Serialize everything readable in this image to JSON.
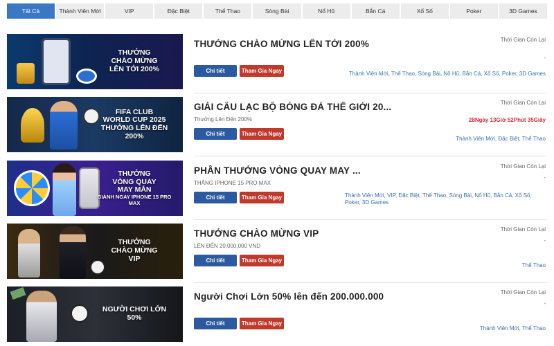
{
  "tabs": [
    "Tất Cả",
    "Thành Viên Mới",
    "VIP",
    "Đặc Biệt",
    "Thể Thao",
    "Sòng Bài",
    "Nổ Hũ",
    "Bắn Cá",
    "Xổ Số",
    "Poker",
    "3D Games"
  ],
  "labels": {
    "detail": "Chi tiết",
    "join": "Tham Gia Ngay",
    "time_remaining": "Thời Gian Còn Lại"
  },
  "promos": [
    {
      "title": "THƯỞNG CHÀO MỪNG LÊN TỚI 200%",
      "subtitle": "",
      "banner": [
        "THƯỞNG",
        "CHÀO MỪNG",
        "LÊN TỚI 200%"
      ],
      "banner_small": "",
      "time": "-",
      "categories": "Thành Viên Mới, Thể Thao, Sòng Bài, Nổ Hũ, Bắn Cá, Xổ Số, Poker, 3D Games"
    },
    {
      "title": "GIẢI CÂU LẠC BỘ BÓNG ĐÁ THẾ GIỚI 20...",
      "subtitle": "Thưởng Lên Đến 200%",
      "banner": [
        "FIFA CLUB",
        "WORLD CUP 2025",
        "THƯỞNG LÊN ĐẾN",
        "200%"
      ],
      "banner_small": "",
      "time": "28Ngày 13Giờ 52Phút 35Giây",
      "categories": "Thành Viên Mới, Đặc Biệt, Thể Thao"
    },
    {
      "title": "PHẦN THƯỞNG VÒNG QUAY MAY ...",
      "subtitle": "THẮNG IPHONE 15 PRO MAX",
      "banner": [
        "THƯỞNG",
        "VÒNG QUAY",
        "MAY MẮN"
      ],
      "banner_small": "GIÀNH NGAY IPHONE 15 PRO MAX",
      "time": "-",
      "categories": "Thành Viên Mới, VIP, Đặc Biệt, Thể Thao, Sòng Bài, Nổ Hũ, Bắn Cá, Xổ Số, Poker, 3D Games"
    },
    {
      "title": "THƯỞNG CHÀO MỪNG VIP",
      "subtitle": "LÊN ĐẾN 20,000,000 VND",
      "banner": [
        "THƯỞNG",
        "CHÀO MỪNG",
        "VIP"
      ],
      "banner_small": "",
      "time": "-",
      "categories": "Thể Thao"
    },
    {
      "title": "Người Chơi Lớn 50% lên đến 200.000.000",
      "subtitle": "",
      "banner": [
        "NGƯỜI CHƠI LỚN",
        "50%"
      ],
      "banner_small": "",
      "time": "-",
      "categories": "Thành Viên Mới, Thể Thao"
    }
  ]
}
